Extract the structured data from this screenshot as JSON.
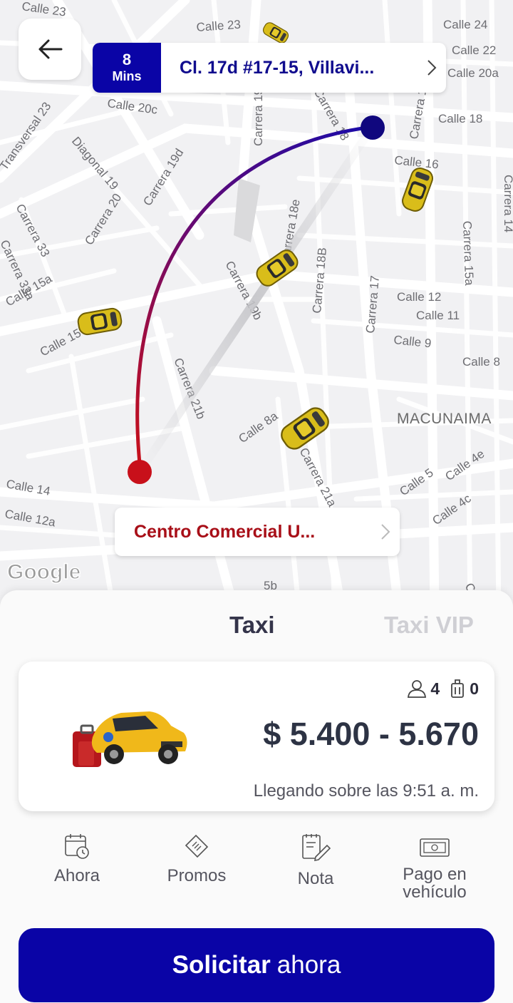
{
  "map": {
    "streets": [
      "Calle 23",
      "Calle 23",
      "Calle 24",
      "Calle 22",
      "Calle 20a",
      "Calle 18",
      "Calle 20c",
      "Transversal 23",
      "Diagonal 19",
      "Carrera 19d",
      "Carrera 20",
      "Carrera 33",
      "Carrera 33a",
      "Calle 15a",
      "Calle 15",
      "Carrera 19",
      "Carrera 18",
      "Carrera 1",
      "Calle 16",
      "Carrera 14",
      "Carrera 18e",
      "Carrera 18B",
      "Carrera 19b",
      "Carrera 17",
      "Calle 12",
      "Calle 11",
      "Calle 9",
      "Calle 8",
      "Carrera 15a",
      "Carrera 21b",
      "Calle 8a",
      "Carrera 21a",
      "Calle 5",
      "Calle 4e",
      "Calle 4c",
      "Calle 14",
      "Calle 12a",
      "5b",
      "Ca"
    ],
    "area_label": "MACUNAIMA",
    "attribution": "Google"
  },
  "eta": {
    "value": "8",
    "unit": "Mins"
  },
  "pickup": {
    "address": "Cl. 17d #17-15, Villavi..."
  },
  "destination": {
    "name": "Centro Comercial U..."
  },
  "tabs": [
    {
      "label": "Taxi",
      "active": true
    },
    {
      "label": "Taxi VIP",
      "active": false
    }
  ],
  "ride": {
    "passengers": "4",
    "luggage": "0",
    "price": "$ 5.400 -  5.670",
    "arrival": "Llegando sobre las 9:51 a. m."
  },
  "options": [
    {
      "label": "Ahora",
      "icon": "calendar-clock-icon"
    },
    {
      "label": "Promos",
      "icon": "coupon-icon"
    },
    {
      "label": "Nota",
      "icon": "note-edit-icon"
    },
    {
      "label_line1": "Pago en",
      "label_line2": "vehículo",
      "icon": "cash-icon"
    }
  ],
  "cta": {
    "bold": "Solicitar",
    "rest": "ahora"
  },
  "colors": {
    "primary": "#0a04a6",
    "destination": "#c8101a",
    "taxi": "#e2c21c"
  }
}
